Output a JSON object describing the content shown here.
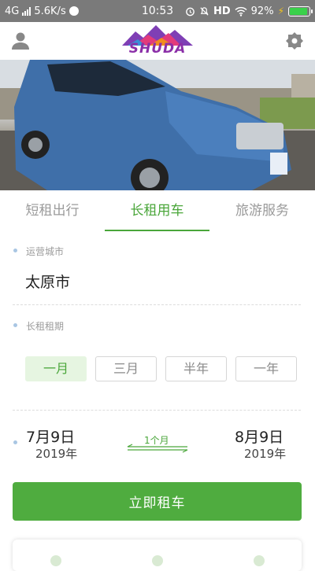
{
  "status_bar": {
    "network": "4G",
    "speed": "5.6K/s",
    "time": "10:53",
    "hd": "HD",
    "battery": "92%",
    "battery_level": 0.92
  },
  "header": {
    "logo_text": "SHUDA",
    "user_icon": "user-icon",
    "right_icon": "gear-icon"
  },
  "tabs": [
    {
      "label": "短租出行",
      "active": false
    },
    {
      "label": "长租用车",
      "active": true
    },
    {
      "label": "旅游服务",
      "active": false
    }
  ],
  "form": {
    "city_label": "运营城市",
    "city_value": "太原市",
    "period_label": "长租租期",
    "periods": [
      {
        "label": "一月",
        "active": true
      },
      {
        "label": "三月",
        "active": false
      },
      {
        "label": "半年",
        "active": false
      },
      {
        "label": "一年",
        "active": false
      }
    ],
    "start_date": "7月9日",
    "start_year": "2019年",
    "duration": "1个月",
    "end_date": "8月9日",
    "end_year": "2019年"
  },
  "submit_label": "立即租车",
  "colors": {
    "accent": "#4fac3f",
    "status_bar": "#7a7a7a"
  }
}
